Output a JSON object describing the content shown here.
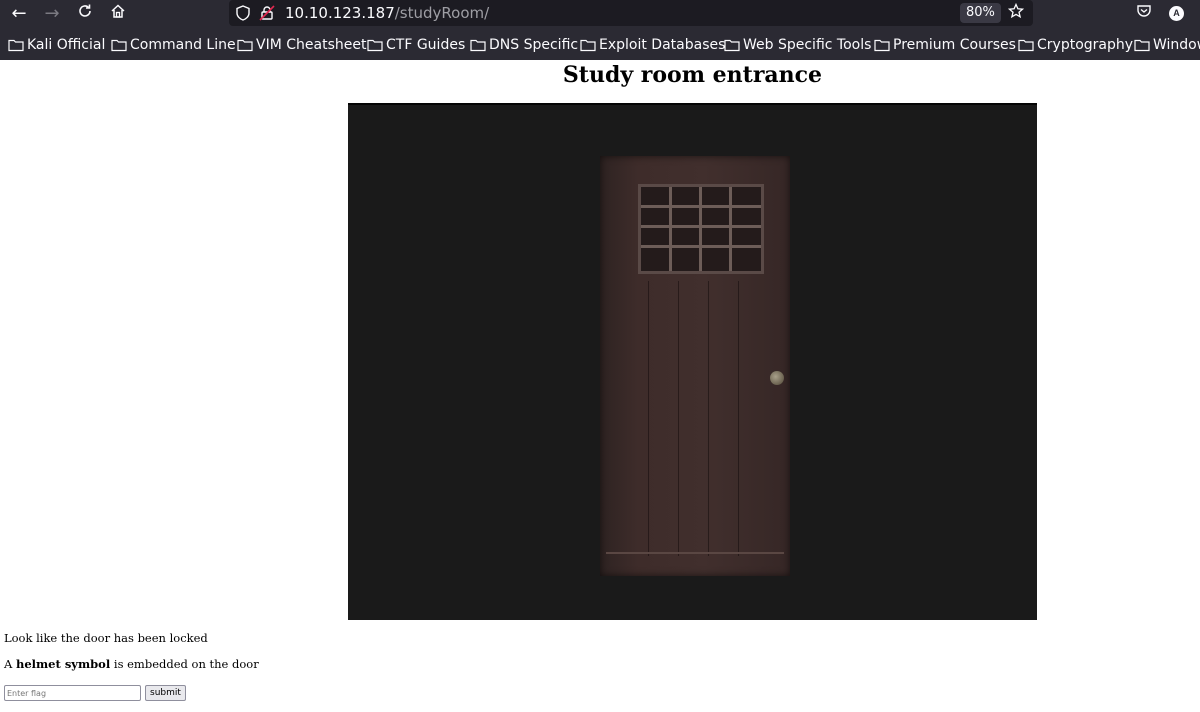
{
  "browser": {
    "url_host": "10.10.123.187",
    "url_path": "/studyRoom/",
    "zoom": "80%",
    "account_initial": "A",
    "icons": {
      "back": "arrow-left-icon",
      "forward": "arrow-right-icon",
      "reload": "reload-icon",
      "home": "home-icon",
      "shield": "shield-icon",
      "insecure": "insecure-lock-icon",
      "star": "star-icon",
      "pocket": "pocket-icon",
      "account": "account-icon",
      "bookmark": "folder-icon"
    },
    "colors": {
      "chrome_bg": "#2b2a33",
      "urlbar_bg": "#1c1b22",
      "text": "#fbfbfe",
      "path_text": "#9e9ea4"
    }
  },
  "bookmarks": [
    "Kali Official",
    "Command Line",
    "VIM Cheatsheet",
    "CTF Guides",
    "DNS Specific",
    "Exploit Databases",
    "Web Specific Tools",
    "Premium Courses",
    "Cryptography",
    "Window"
  ],
  "page": {
    "title": "Study room entrance",
    "image_subject": "door",
    "para1": "Look like the door has been locked",
    "para2_prefix": "A ",
    "para2_bold": "helmet symbol",
    "para2_suffix": " is embedded on the door",
    "input_placeholder": "Enter flag",
    "submit_label": "submit"
  }
}
